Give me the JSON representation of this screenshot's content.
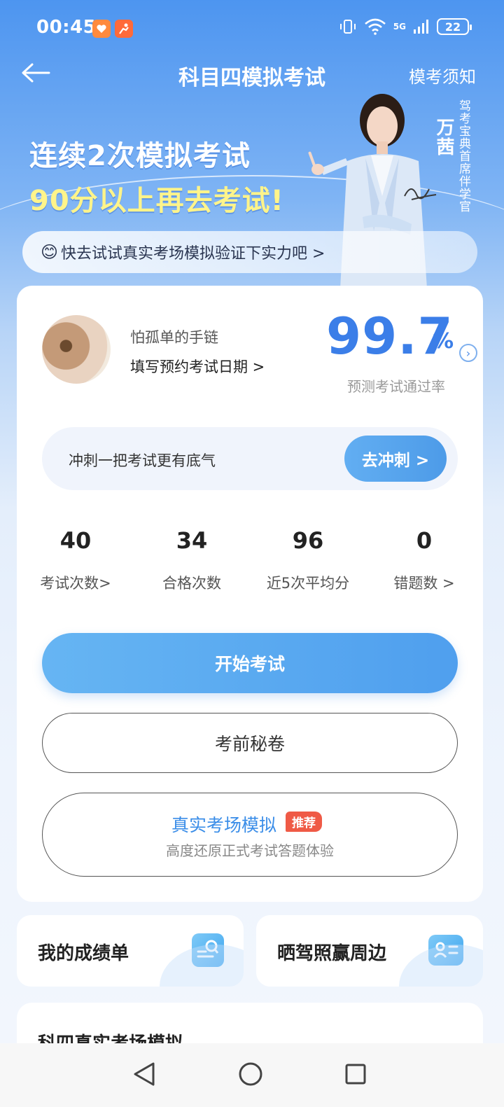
{
  "status_bar": {
    "time": "00:45",
    "network": "5G",
    "battery": "22",
    "icons": [
      "vibrate-icon",
      "wifi-icon",
      "signal-icon"
    ]
  },
  "nav": {
    "title": "科目四模拟考试",
    "right_link": "模考须知"
  },
  "banner": {
    "line1": "连续2次模拟考试",
    "line2": "90分以上再去考试!",
    "presenter_name": "万茜",
    "presenter_title": "驾考宝典首席伴学官",
    "tip": "快去试试真实考场模拟验证下实力吧 >"
  },
  "profile": {
    "username": "怕孤单的手链",
    "exam_date_link": "填写预约考试日期 >",
    "pass_rate": "99.7",
    "pass_rate_unit": "%",
    "pass_rate_label": "预测考试通过率"
  },
  "sprint": {
    "text": "冲刺一把考试更有底气",
    "button": "去冲刺 >"
  },
  "stats": [
    {
      "value": "40",
      "label": "考试次数>"
    },
    {
      "value": "34",
      "label": "合格次数"
    },
    {
      "value": "96",
      "label": "近5次平均分"
    },
    {
      "value": "0",
      "label": "错题数 >"
    }
  ],
  "actions": {
    "start": "开始考试",
    "secret": "考前秘卷",
    "real_title": "真实考场模拟",
    "real_badge": "推荐",
    "real_sub": "高度还原正式考试答题体验"
  },
  "mini_cards": {
    "left": "我的成绩单",
    "right": "晒驾照赢周边"
  },
  "peek_card": {
    "label": "科四真实考场模拟"
  },
  "colors": {
    "accent": "#3b7ee8",
    "button_blue": "#56a6ef",
    "badge_red": "#ef5a46",
    "banner_yellow": "#fff48a"
  }
}
